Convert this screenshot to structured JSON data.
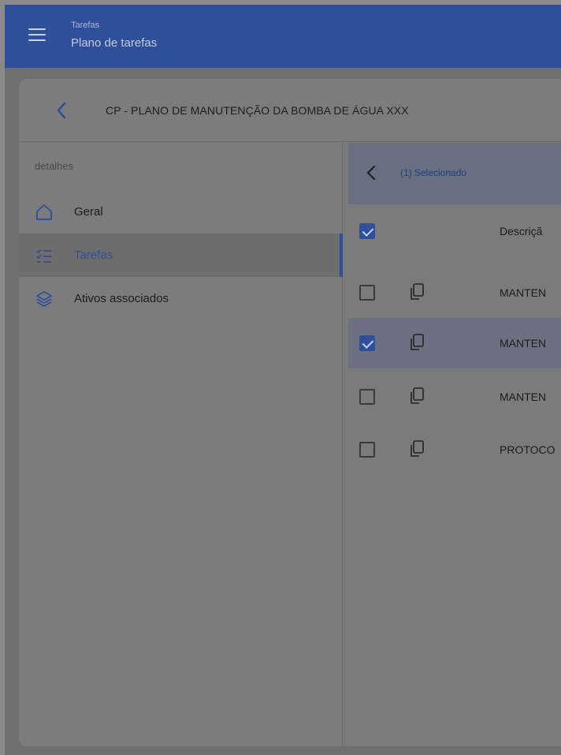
{
  "appbar": {
    "title": "Tarefas",
    "subtitle": "Plano de tarefas",
    "menu_icon": "hamburger-menu-icon"
  },
  "header": {
    "back_icon": "chevron-left-icon",
    "title": "CP - PLANO DE MANUTENÇÃO DA BOMBA DE ÁGUA XXX"
  },
  "sidebar": {
    "section_label": "detalhes",
    "items": [
      {
        "label": "Geral",
        "icon": "home-icon",
        "active": false
      },
      {
        "label": "Tarefas",
        "icon": "checklist-icon",
        "active": true
      },
      {
        "label": "Ativos associados",
        "icon": "layers-icon",
        "active": false
      }
    ]
  },
  "tasks_panel": {
    "selection_label": "(1) Selecionado",
    "column_header": "Descriçã",
    "rows": [
      {
        "text": "MANTEN",
        "checked": false
      },
      {
        "text": "MANTEN",
        "checked": true
      },
      {
        "text": "MANTEN",
        "checked": false
      },
      {
        "text": "PROTOCO",
        "checked": false
      }
    ]
  },
  "colors": {
    "primary": "#2f4f9a",
    "overlay_background": "#7b7b7b"
  }
}
